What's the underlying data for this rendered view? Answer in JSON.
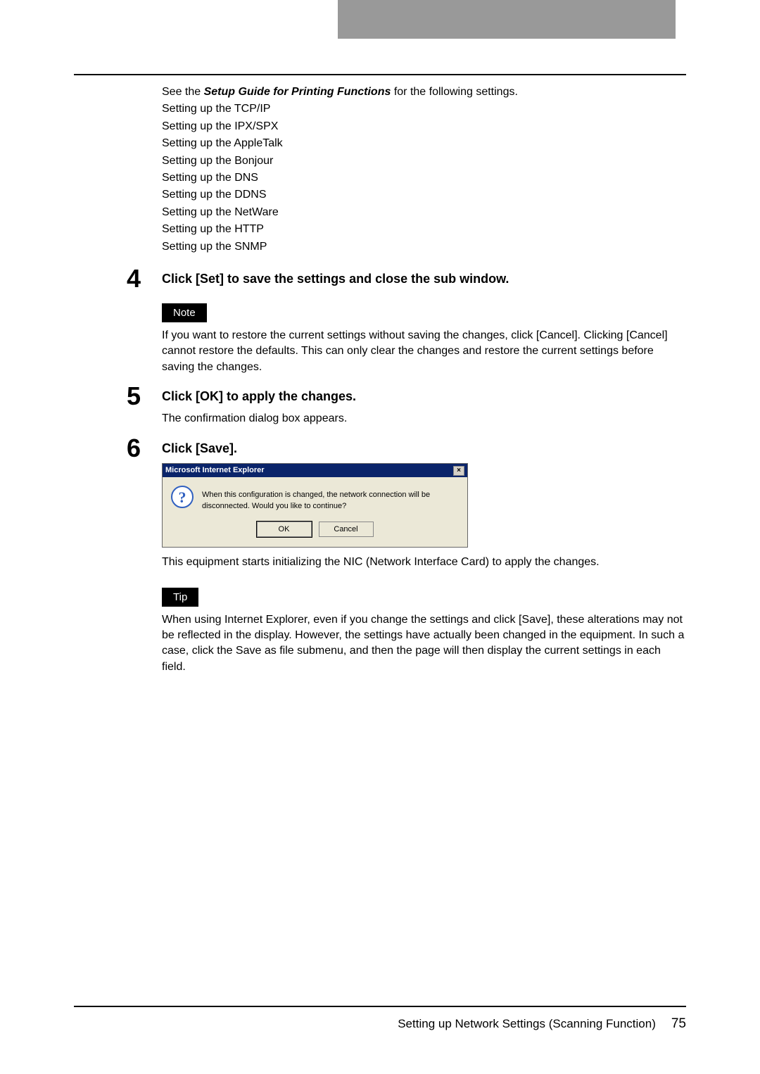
{
  "intro": {
    "prefix": "See the ",
    "bold": "Setup Guide for Printing Functions",
    "suffix": " for the following settings."
  },
  "settings": [
    "Setting up the TCP/IP",
    "Setting up the IPX/SPX",
    "Setting up the AppleTalk",
    "Setting up the Bonjour",
    "Setting up the DNS",
    "Setting up the DDNS",
    "Setting up the NetWare",
    "Setting up the HTTP",
    "Setting up the SNMP"
  ],
  "step4": {
    "number": "4",
    "title": "Click [Set] to save the settings and close the sub window.",
    "noteLabel": "Note",
    "noteText": "If you want to restore the current settings without saving the changes, click [Cancel]. Clicking [Cancel] cannot restore the defaults.  This can only clear the changes and restore the current settings before saving the changes."
  },
  "step5": {
    "number": "5",
    "title": "Click [OK] to apply the changes.",
    "desc": "The confirmation dialog box appears."
  },
  "step6": {
    "number": "6",
    "title": "Click [Save].",
    "dialog": {
      "titlebar": "Microsoft Internet Explorer",
      "message": "When this configuration is changed, the network connection will be disconnected.  Would you like to continue?",
      "ok": "OK",
      "cancel": "Cancel"
    },
    "after": "This equipment starts initializing the NIC (Network Interface Card) to apply the changes.",
    "tipLabel": "Tip",
    "tipText": "When using Internet Explorer, even if you change the settings and click [Save], these alterations may not be reflected in the display. However, the settings have actually been changed in the equipment. In such a case, click the Save as file submenu, and then the page will then display the current settings in each field."
  },
  "footer": {
    "title": "Setting up Network Settings (Scanning Function)",
    "page": "75"
  }
}
